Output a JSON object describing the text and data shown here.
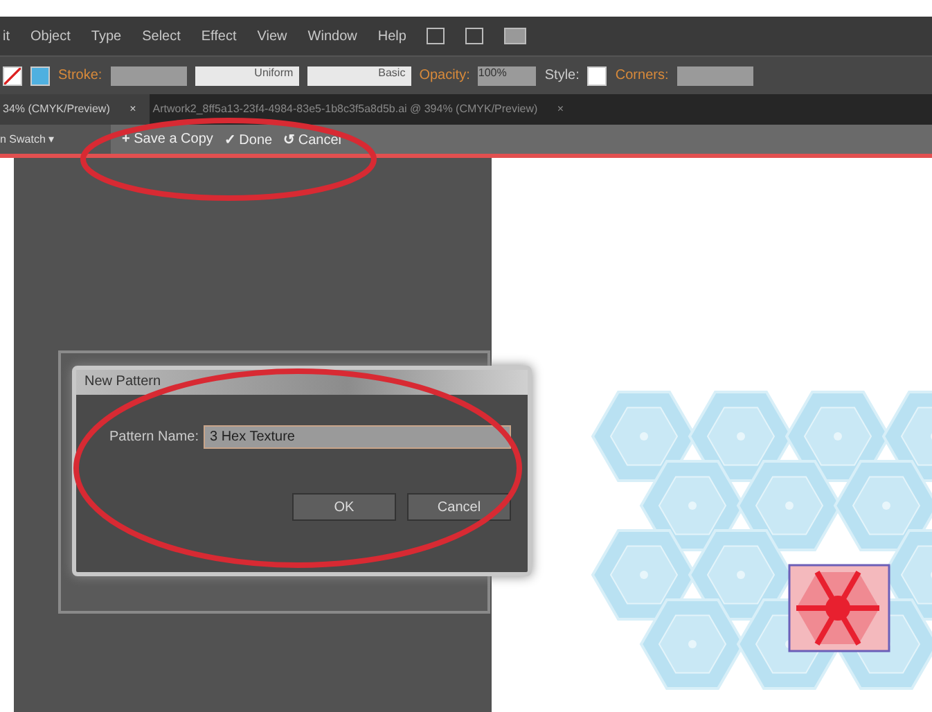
{
  "menu": [
    "it",
    "Object",
    "Type",
    "Select",
    "Effect",
    "View",
    "Window",
    "Help"
  ],
  "control_bar": {
    "stroke_label": "Stroke:",
    "profile": "Uniform",
    "brush": "Basic",
    "opacity_label": "Opacity:",
    "opacity": "100%",
    "style_label": "Style:",
    "corners_label": "Corners:"
  },
  "tabs": [
    {
      "label": "34% (CMYK/Preview)",
      "selected": true,
      "close": "×"
    },
    {
      "label": "Artwork2_8ff5a13-23f4-4984-83e5-1b8c3f5a8d5b.ai @ 394% (CMYK/Preview)",
      "selected": false,
      "close": "×"
    }
  ],
  "pattern_bar": {
    "swatch": "n Swatch ▾",
    "actions": [
      {
        "icon": "+",
        "label": "Save a Copy"
      },
      {
        "icon": "✓",
        "label": "Done"
      },
      {
        "icon": "↺",
        "label": "Cancel"
      }
    ]
  },
  "dialog": {
    "title": "New Pattern",
    "field_label": "Pattern Name:",
    "field_value": "3 Hex Texture",
    "buttons": [
      "OK",
      "Cancel"
    ]
  }
}
